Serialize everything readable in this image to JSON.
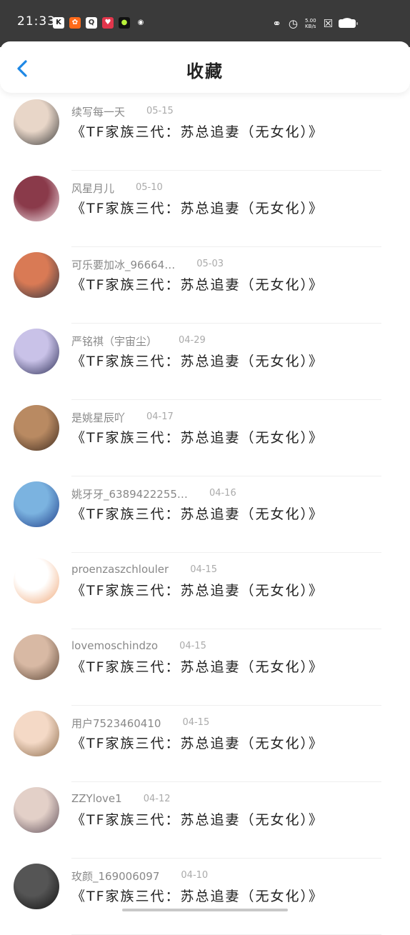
{
  "status_bar": {
    "time": "21:33",
    "net_speed_top": "5.00",
    "net_speed_bottom": "KB/s",
    "apps": [
      {
        "icon": "k-app-icon",
        "glyph": "K",
        "bg": "#ffffff",
        "fg": "#222222"
      },
      {
        "icon": "orange-app-icon",
        "glyph": "✿",
        "bg": "#ff6a1a",
        "fg": "#ffffff"
      },
      {
        "icon": "search-app-icon",
        "glyph": "Q",
        "bg": "#ffffff",
        "fg": "#333333"
      },
      {
        "icon": "red-app-icon",
        "glyph": "♥",
        "bg": "#e2364c",
        "fg": "#ffffff"
      },
      {
        "icon": "green-app-icon",
        "glyph": "●",
        "bg": "#111111",
        "fg": "#b8f23a"
      },
      {
        "icon": "qq-icon",
        "glyph": "◉",
        "bg": "#3a3a3a",
        "fg": "#ffffff"
      }
    ]
  },
  "header": {
    "title": "收藏",
    "accent_color": "#1e88e5"
  },
  "favorites": [
    {
      "user": "续写每一天",
      "date": "05-15",
      "book": "《TF家族三代：苏总追妻（无女化）》",
      "avatar_colors": [
        "#e8d6c8",
        "#3b3b3b"
      ]
    },
    {
      "user": "风星月儿",
      "date": "05-10",
      "book": "《TF家族三代：苏总追妻（无女化）》",
      "avatar_colors": [
        "#8a3a4a",
        "#f2e4ea"
      ]
    },
    {
      "user": "可乐要加冰_96664…",
      "date": "05-03",
      "book": "《TF家族三代：苏总追妻（无女化）》",
      "avatar_colors": [
        "#d97a55",
        "#2f3440"
      ]
    },
    {
      "user": "严铭祺（宇宙尘）",
      "date": "04-29",
      "book": "《TF家族三代：苏总追妻（无女化）》",
      "avatar_colors": [
        "#c9c2e8",
        "#2b2d55"
      ]
    },
    {
      "user": "是姚星辰吖",
      "date": "04-17",
      "book": "《TF家族三代：苏总追妻（无女化）》",
      "avatar_colors": [
        "#b98a62",
        "#3e2b1f"
      ]
    },
    {
      "user": "姚牙牙_6389422255…",
      "date": "04-16",
      "book": "《TF家族三代：苏总追妻（无女化）》",
      "avatar_colors": [
        "#7bb3e0",
        "#1f3e8a"
      ]
    },
    {
      "user": "proenzaszchlouler",
      "date": "04-15",
      "book": "《TF家族三代：苏总追妻（无女化）》",
      "avatar_colors": [
        "#ffffff",
        "#f0a878"
      ]
    },
    {
      "user": "lovemoschindzo",
      "date": "04-15",
      "book": "《TF家族三代：苏总追妻（无女化）》",
      "avatar_colors": [
        "#d8b9a4",
        "#5a4434"
      ]
    },
    {
      "user": "用户7523460410",
      "date": "04-15",
      "book": "《TF家族三代：苏总追妻（无女化）》",
      "avatar_colors": [
        "#f4d9c6",
        "#8a6a4a"
      ]
    },
    {
      "user": "ZZYlove1",
      "date": "04-12",
      "book": "《TF家族三代：苏总追妻（无女化）》",
      "avatar_colors": [
        "#e3d0c8",
        "#5f4f5a"
      ]
    },
    {
      "user": "玫颜_169006097",
      "date": "04-10",
      "book": "《TF家族三代：苏总追妻（无女化）》",
      "avatar_colors": [
        "#555555",
        "#111111"
      ]
    }
  ]
}
